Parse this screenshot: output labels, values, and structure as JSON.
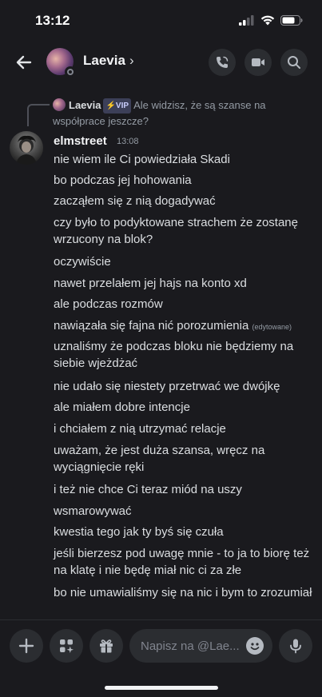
{
  "status_bar": {
    "time": "13:12"
  },
  "header": {
    "channel_name": "Laevia",
    "chevron": "›"
  },
  "reply": {
    "author": "Laevia",
    "badge": "⚡VIP",
    "text": "Ale widzisz, że są szanse na współprace jeszcze?"
  },
  "message_group": {
    "author": "elmstreet",
    "time": "13:08",
    "messages": [
      {
        "text": "nie wiem ile Ci powiedziała Skadi"
      },
      {
        "text": "bo podczas jej hohowania"
      },
      {
        "text": "zacząłem się z nią dogadywać"
      },
      {
        "text": "czy było to podyktowane strachem że zostanę wrzucony na blok?"
      },
      {
        "text": "oczywiście"
      },
      {
        "text": "nawet przelałem jej hajs na konto xd"
      },
      {
        "text": "ale podczas rozmów"
      },
      {
        "text": "nawiązała się fajna nić porozumienia",
        "edited": "(edytowane)"
      },
      {
        "text": "uznaliśmy że podczas bloku nie będziemy na siebie wjeżdżać"
      },
      {
        "text": "nie udało się niestety przetrwać we dwójkę"
      },
      {
        "text": "ale miałem dobre intencje"
      },
      {
        "text": "i chciałem z nią utrzymać relacje"
      },
      {
        "text": "uważam, że jest duża szansa, wręcz na wyciągnięcie ręki"
      },
      {
        "text": "i też nie chce Ci teraz miód na uszy"
      },
      {
        "text": "wsmarowywać"
      },
      {
        "text": "kwestia tego jak ty byś się czuła"
      },
      {
        "text": "jeśli bierzesz pod uwagę mnie - to ja to biorę też na klatę i nie będę miał nic ci za złe"
      },
      {
        "text": "bo nie umawialiśmy się na nic i bym to zrozumiał"
      }
    ]
  },
  "composer": {
    "placeholder": "Napisz na @Lae..."
  },
  "icons": {
    "back": "back-arrow-icon",
    "call": "phone-call-icon",
    "video": "video-camera-icon",
    "search": "search-icon",
    "plus": "plus-icon",
    "apps": "apps-sparkle-icon",
    "gift": "gift-icon",
    "emoji": "emoji-icon",
    "mic": "microphone-icon"
  }
}
